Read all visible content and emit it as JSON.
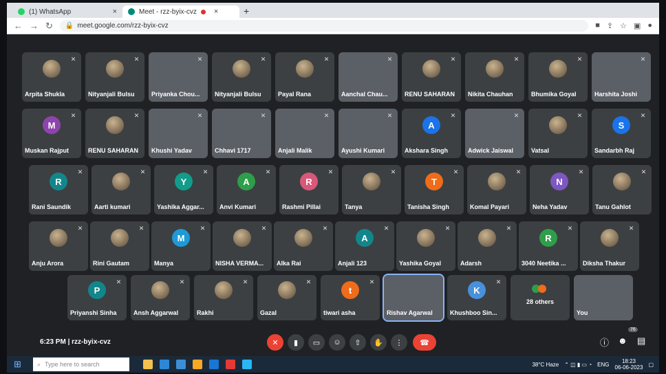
{
  "browser": {
    "tabs": [
      {
        "label": "(1) WhatsApp",
        "active": false
      },
      {
        "label": "Meet - rzz-byix-cvz",
        "active": true
      }
    ],
    "url": "meet.google.com/rzz-byix-cvz"
  },
  "participants": [
    {
      "name": "Arpita Shukla",
      "kind": "photo"
    },
    {
      "name": "Nityanjali Bulsu",
      "kind": "photo"
    },
    {
      "name": "Priyanka Chou...",
      "kind": "video"
    },
    {
      "name": "Nityanjali Bulsu",
      "kind": "photo"
    },
    {
      "name": "Payal Rana",
      "kind": "photo"
    },
    {
      "name": "Aanchal Chau...",
      "kind": "video"
    },
    {
      "name": "RENU SAHARAN",
      "kind": "photo"
    },
    {
      "name": "Nikita Chauhan",
      "kind": "photo"
    },
    {
      "name": "Bhumika Goyal",
      "kind": "photo"
    },
    {
      "name": "Harshita Joshi",
      "kind": "video"
    },
    {
      "name": "Muskan Rajput",
      "kind": "letter",
      "letter": "M",
      "color": "#8e44ad"
    },
    {
      "name": "RENU SAHARAN",
      "kind": "photo"
    },
    {
      "name": "Khushi Yadav",
      "kind": "video"
    },
    {
      "name": "Chhavi 1717",
      "kind": "video"
    },
    {
      "name": "Anjali Malik",
      "kind": "video"
    },
    {
      "name": "Ayushi Kumari",
      "kind": "video"
    },
    {
      "name": "Akshara Singh",
      "kind": "letter",
      "letter": "A",
      "color": "#1a73e8"
    },
    {
      "name": "Adwick Jaiswal",
      "kind": "video"
    },
    {
      "name": "Vatsal",
      "kind": "photo"
    },
    {
      "name": "Sandarbh Raj",
      "kind": "letter",
      "letter": "S",
      "color": "#1a73e8"
    },
    {
      "name": "Rani Saundik",
      "kind": "letter",
      "letter": "R",
      "color": "#12868a"
    },
    {
      "name": "Aarti kumari",
      "kind": "photo"
    },
    {
      "name": "Yashika Aggar...",
      "kind": "letter",
      "letter": "Y",
      "color": "#129c8a"
    },
    {
      "name": "Anvi Kumari",
      "kind": "letter",
      "letter": "A",
      "color": "#2e9e4a"
    },
    {
      "name": "Rashmi Pillai",
      "kind": "letter",
      "letter": "R",
      "color": "#d8587a"
    },
    {
      "name": "Tanya",
      "kind": "photo"
    },
    {
      "name": "Tanisha Singh",
      "kind": "letter",
      "letter": "T",
      "color": "#ef6c1a"
    },
    {
      "name": "Komal Payari",
      "kind": "photo"
    },
    {
      "name": "Neha Yadav",
      "kind": "letter",
      "letter": "N",
      "color": "#7e57c2"
    },
    {
      "name": "Tanu Gahlot",
      "kind": "photo"
    },
    {
      "name": "Anju Arora",
      "kind": "photo"
    },
    {
      "name": "Rini Gautam",
      "kind": "photo"
    },
    {
      "name": "Manya",
      "kind": "letter",
      "letter": "M",
      "color": "#1e9ad6"
    },
    {
      "name": "NISHA VERMA...",
      "kind": "photo"
    },
    {
      "name": "Alka Rai",
      "kind": "photo"
    },
    {
      "name": "Anjali 123",
      "kind": "letter",
      "letter": "A",
      "color": "#12868a"
    },
    {
      "name": "Yashika Goyal",
      "kind": "photo"
    },
    {
      "name": "Adarsh",
      "kind": "photo"
    },
    {
      "name": "3040 Neetika ...",
      "kind": "letter",
      "letter": "R",
      "color": "#2e9e4a"
    },
    {
      "name": "Diksha Thakur",
      "kind": "photo"
    },
    {
      "name": "Priyanshi Sinha",
      "kind": "letter",
      "letter": "P",
      "color": "#12868a"
    },
    {
      "name": "Ansh Aggarwal",
      "kind": "photo"
    },
    {
      "name": "Rakhi",
      "kind": "photo"
    },
    {
      "name": "Gazal",
      "kind": "photo"
    },
    {
      "name": "tiwari asha",
      "kind": "letter",
      "letter": "t",
      "color": "#ef6c1a"
    },
    {
      "name": "Rishav Agarwal",
      "kind": "video",
      "speaking": true
    },
    {
      "name": "Khushboo Sin...",
      "kind": "letter",
      "letter": "K",
      "color": "#4a90d9"
    },
    {
      "name": "28 others",
      "kind": "others"
    },
    {
      "name": "You",
      "kind": "video"
    }
  ],
  "controls": {
    "meeting_info": "6:23 PM  |  rzz-byix-cvz",
    "people_count": "76"
  },
  "taskbar": {
    "search_placeholder": "Type here to search",
    "weather": "38°C Haze",
    "language": "ENG",
    "time": "18:23",
    "date": "06-06-2023"
  }
}
